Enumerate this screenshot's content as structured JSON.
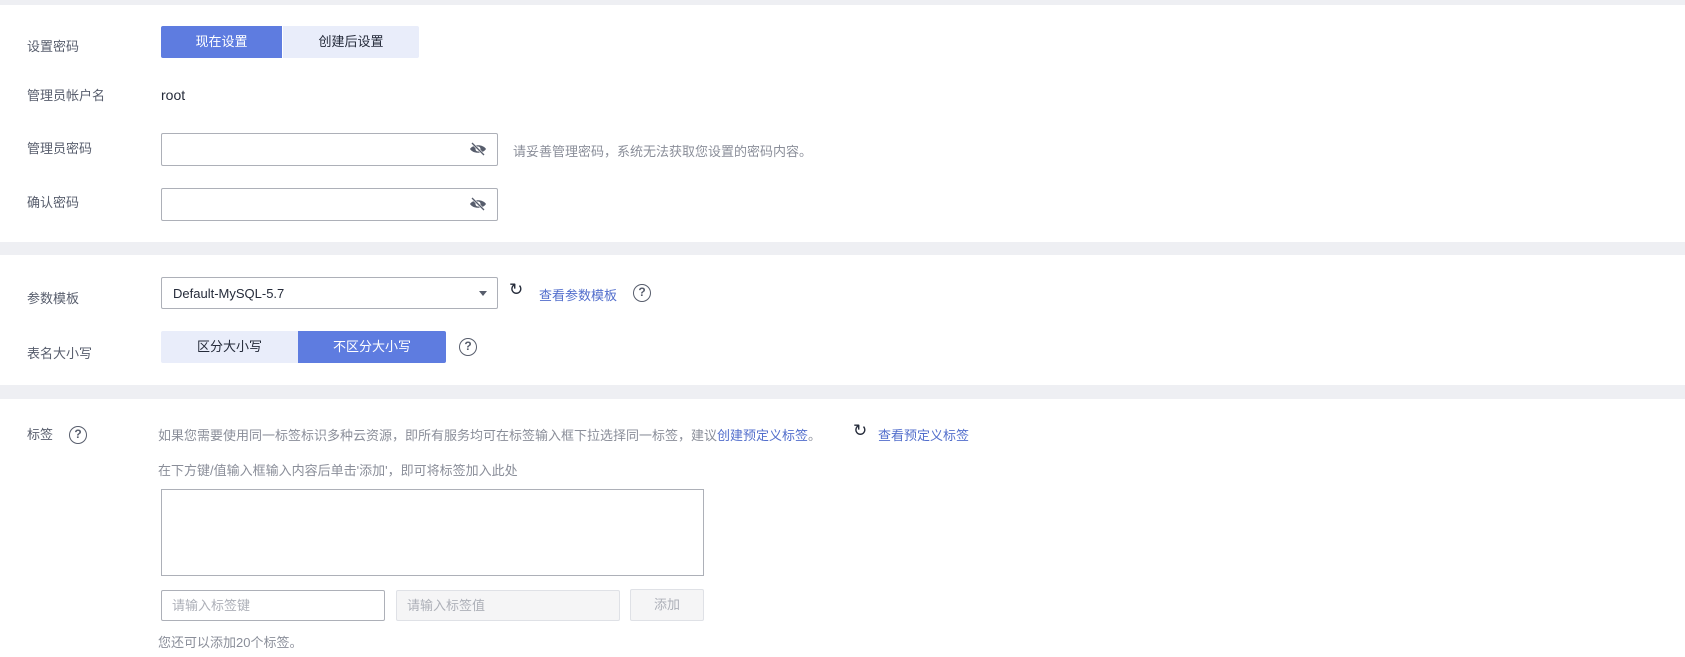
{
  "password": {
    "label": "设置密码",
    "now": "现在设置",
    "later": "创建后设置"
  },
  "admin_user": {
    "label": "管理员帐户名",
    "value": "root"
  },
  "admin_pwd": {
    "label": "管理员密码",
    "value": "",
    "hint": "请妥善管理密码，系统无法获取您设置的密码内容。"
  },
  "confirm_pwd": {
    "label": "确认密码",
    "value": ""
  },
  "param": {
    "label": "参数模板",
    "value": "Default-MySQL-5.7",
    "link": "查看参数模板"
  },
  "case": {
    "label": "表名大小写",
    "opt1": "区分大小写",
    "opt2": "不区分大小写"
  },
  "tags": {
    "label": "标签",
    "desc": "如果您需要使用同一标签标识多种云资源，即所有服务均可在标签输入框下拉选择同一标签，建议",
    "create_link": "创建预定义标签",
    "period": "。",
    "view_link": "查看预定义标签",
    "instr": "在下方键/值输入框输入内容后单击'添加'，即可将标签加入此处",
    "key_placeholder": "请输入标签键",
    "value_placeholder": "请输入标签值",
    "add": "添加",
    "remain": "您还可以添加20个标签。"
  },
  "colors": {
    "primary": "#5e7ce0",
    "link": "#526ecc"
  }
}
